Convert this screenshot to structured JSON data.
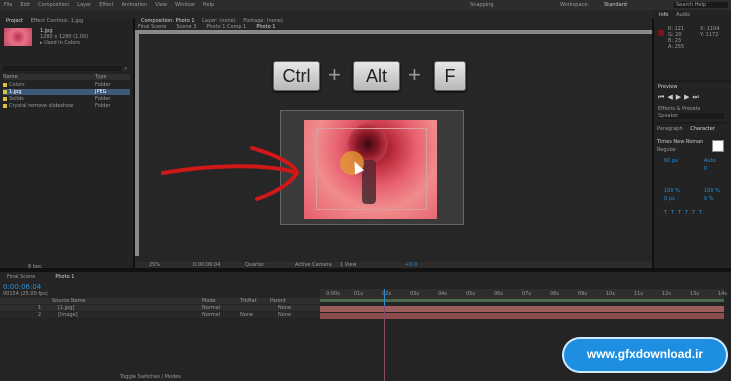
{
  "menu_items": [
    "File",
    "Edit",
    "Composition",
    "Layer",
    "Effect",
    "Animation",
    "View",
    "Window",
    "Help"
  ],
  "toolbar": {
    "snapping_label": "Snapping",
    "workspace_label": "Workspace:",
    "workspace_value": "Standard",
    "search_placeholder": "Search Help"
  },
  "project": {
    "tab_label": "Project",
    "effect_controls_label": "Effect Controls: 1.jpg",
    "selected_name": "1.jpg",
    "selected_info": "1280 x 1280 (1.00)",
    "selected_usage": "▸ Used in Colors",
    "col_name": "Name",
    "col_type": "Type",
    "items": [
      {
        "name": "Colors",
        "type": "Folder"
      },
      {
        "name": "1.jpg",
        "type": "JPEG"
      },
      {
        "name": "Solids",
        "type": "Folder"
      },
      {
        "name": "Crystal remove slideshow",
        "type": "Folder"
      }
    ],
    "bpc": "8 bpc"
  },
  "composition": {
    "panel_label": "Composition: Photo 1",
    "layer_label": "Layer: (none)",
    "footage_label": "Footage: (none)",
    "breadcrumbs": [
      "Final Scene",
      "Scene 3",
      "Photo 1 Comp 1",
      "Photo 1"
    ],
    "zoom": "25%",
    "timecode": "0:00:06:04",
    "quality": "Quarter",
    "camera": "Active Camera",
    "views": "1 View",
    "offset": "+0.0"
  },
  "shortcut": {
    "keys": [
      "Ctrl",
      "Alt",
      "F"
    ],
    "plus": "+"
  },
  "info": {
    "tab_label": "Info",
    "audio_label": "Audio",
    "r": "R: 121",
    "g": "G: 20",
    "b": "B: 23",
    "a": "A: 255",
    "x": "X: 1104",
    "y": "Y: 1172"
  },
  "preview": {
    "tab_label": "Preview",
    "effects_label": "Effects & Presets",
    "search_placeholder": "Speaker"
  },
  "character": {
    "tab_label": "Character",
    "paragraph_label": "Paragraph",
    "font": "Times New Roman",
    "style": "Regular",
    "size": "60 px",
    "leading": "Auto",
    "tracking": "0",
    "scale_v": "100 %",
    "scale_h": "100 %",
    "baseline": "0 px",
    "tsume": "0 %"
  },
  "timeline": {
    "tabs": [
      "Final Scene",
      "Photo 1"
    ],
    "timecode": "0:00:06:04",
    "frame_info": "00154 (25.00 fps)",
    "col_source": "Source Name",
    "col_mode": "Mode",
    "col_trkmat": "TrkMat",
    "col_parent": "Parent",
    "layers": [
      {
        "num": "1",
        "name": "[1.jpg]",
        "mode": "Normal",
        "trkmat": "",
        "parent": "None"
      },
      {
        "num": "2",
        "name": "[Image]",
        "mode": "Normal",
        "trkmat": "None",
        "parent": "None"
      }
    ],
    "ticks": [
      "0:00s",
      "01s",
      "02s",
      "03s",
      "04s",
      "05s",
      "06s",
      "07s",
      "08s",
      "09s",
      "10s",
      "11s",
      "12s",
      "13s",
      "14s"
    ],
    "toggle_label": "Toggle Switches / Modes"
  },
  "watermark": "www.gfxdownload.ir",
  "colors": {
    "accent": "#2a8fd8",
    "background": "#1c1c1c",
    "panel": "#232323",
    "arrow": "#d01818"
  }
}
